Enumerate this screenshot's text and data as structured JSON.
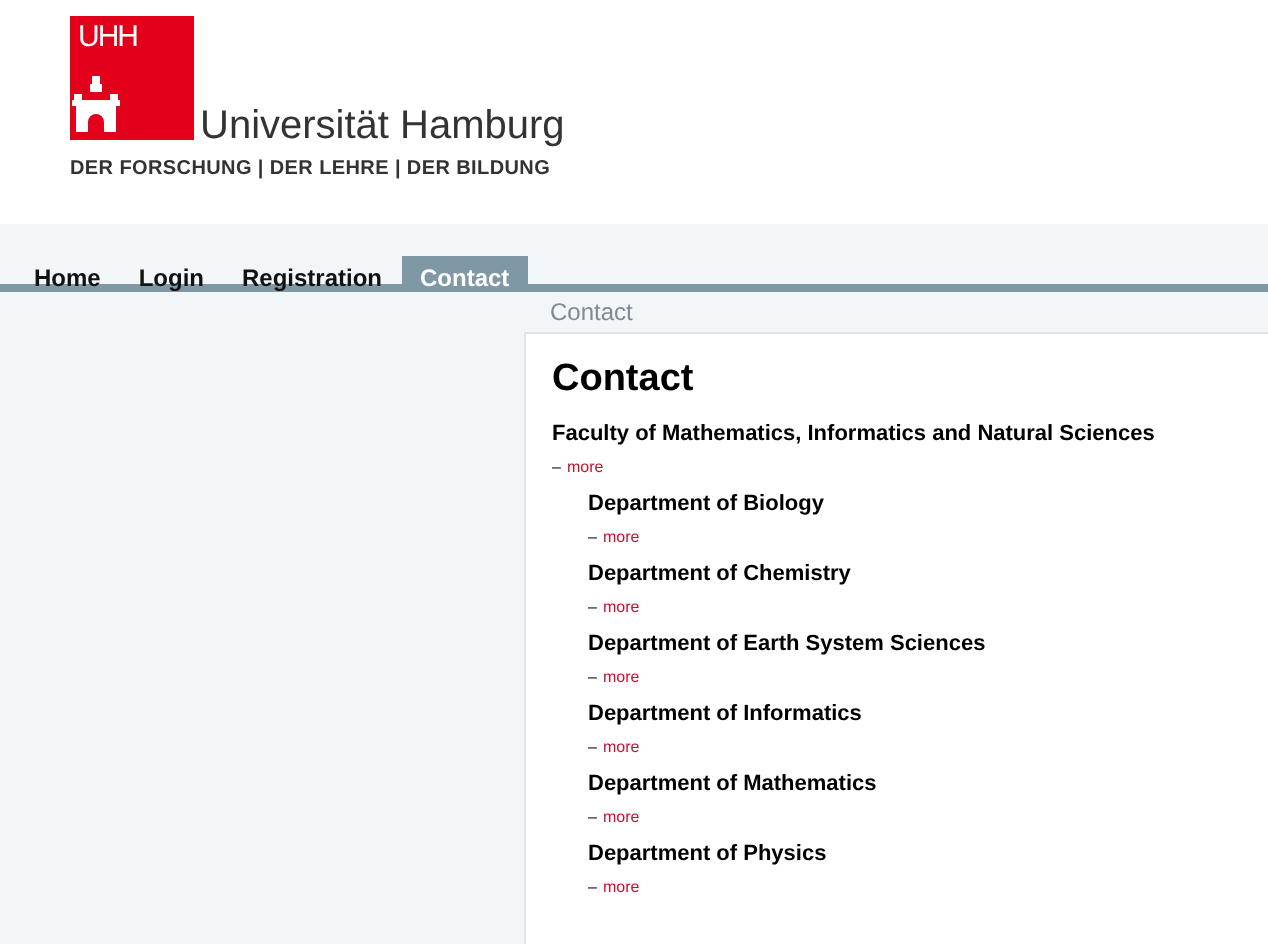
{
  "logo": {
    "mark": "UHH",
    "name": "Universität Hamburg",
    "tagline": "DER FORSCHUNG | DER LEHRE | DER BILDUNG"
  },
  "nav": [
    {
      "label": "Home",
      "selected": false
    },
    {
      "label": "Login",
      "selected": false
    },
    {
      "label": "Registration",
      "selected": false
    },
    {
      "label": "Contact",
      "selected": true
    }
  ],
  "breadcrumb": "Contact",
  "heading": "Contact",
  "faculty": {
    "name": "Faculty of Mathematics, Informatics and Natural Sciences",
    "dash": "–",
    "link": "more"
  },
  "departments": [
    {
      "name": "Department of Biology",
      "dash": "–",
      "link": "more"
    },
    {
      "name": "Department of Chemistry",
      "dash": "–",
      "link": "more"
    },
    {
      "name": "Department of Earth System Sciences",
      "dash": "–",
      "link": "more"
    },
    {
      "name": "Department of Informatics",
      "dash": "–",
      "link": "more"
    },
    {
      "name": "Department of Mathematics",
      "dash": "–",
      "link": "more"
    },
    {
      "name": "Department of Physics",
      "dash": "–",
      "link": "more"
    }
  ]
}
